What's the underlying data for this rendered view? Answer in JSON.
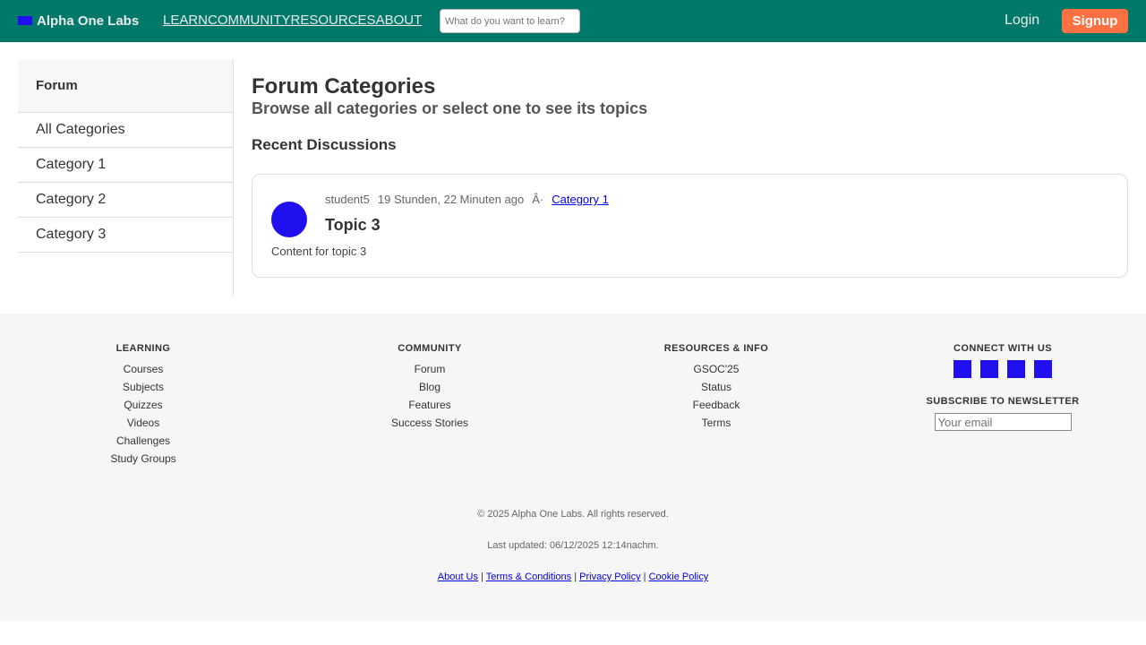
{
  "header": {
    "brand": "Alpha One Labs",
    "nav": [
      "LEARN",
      "COMMUNITY",
      "RESOURCES",
      "ABOUT"
    ],
    "search_placeholder": "What do you want to learn?",
    "login": "Login",
    "signup": "Signup",
    "colors": {
      "bar": "#00796b",
      "signup": "#ff7043"
    }
  },
  "sidebar": {
    "title": "Forum",
    "items": [
      "All Categories",
      "Category 1",
      "Category 2",
      "Category 3"
    ]
  },
  "main": {
    "title": "Forum Categories",
    "subtitle": "Browse all categories or select one to see its topics",
    "recent_heading": "Recent Discussions",
    "topic": {
      "author": "student5",
      "time": "19 Stunden, 22 Minuten ago",
      "separator": "Â·",
      "category": "Category 1",
      "title": "Topic 3",
      "content": "Content for topic 3"
    }
  },
  "footer": {
    "learning": {
      "title": "LEARNING",
      "links": [
        "Courses",
        "Subjects",
        "Quizzes",
        "Videos",
        "Challenges",
        "Study Groups"
      ]
    },
    "community": {
      "title": "COMMUNITY",
      "links": [
        "Forum",
        "Blog",
        "Features",
        "Success Stories"
      ]
    },
    "resources": {
      "title": "RESOURCES & INFO",
      "links": [
        "GSOC'25",
        "Status",
        "Feedback",
        "Terms"
      ]
    },
    "connect": {
      "title": "CONNECT WITH US",
      "social_icons": [
        "social-icon-1",
        "social-icon-2",
        "social-icon-3",
        "social-icon-4"
      ]
    },
    "newsletter": {
      "title": "SUBSCRIBE TO NEWSLETTER",
      "placeholder": "Your email"
    },
    "copyright": "© 2025 Alpha One Labs. All rights reserved.",
    "updated": "Last updated: 06/12/2025 12:14nachm.",
    "legal": [
      "About Us",
      "Terms & Conditions",
      "Privacy Policy",
      "Cookie Policy"
    ],
    "legal_sep": "|"
  }
}
